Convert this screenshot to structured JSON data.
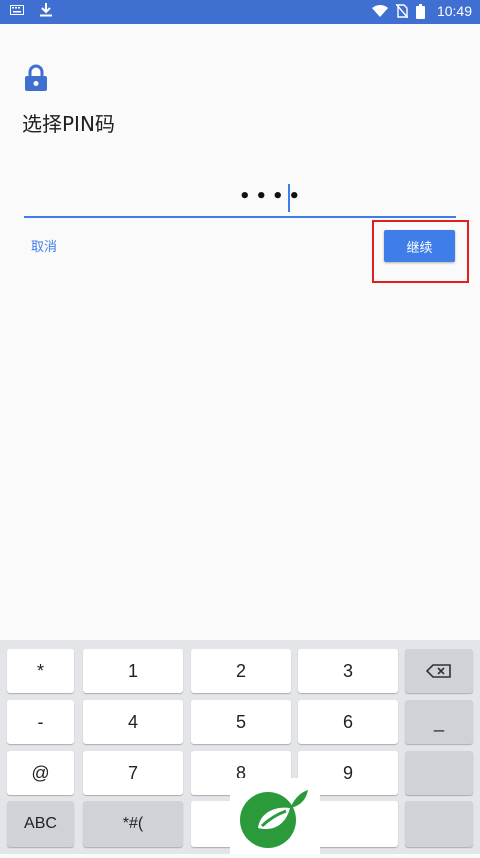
{
  "status_bar": {
    "time": "10:49",
    "left_icons": [
      "keyboard-icon",
      "download-icon"
    ],
    "right_icons": [
      "wifi-icon",
      "no-sim-icon",
      "battery-icon"
    ],
    "background": "#3f6fd1"
  },
  "screen": {
    "title": "选择PIN码",
    "pin_masked": "••••",
    "cancel_label": "取消",
    "continue_label": "继续",
    "accent": "#3f7ee8"
  },
  "keyboard": {
    "rows": [
      [
        "*",
        "1",
        "2",
        "3",
        "backspace"
      ],
      [
        "-",
        "4",
        "5",
        "6",
        "_"
      ],
      [
        "@",
        "7",
        "8",
        "9",
        ""
      ],
      [
        "ABC",
        "*#(",
        "",
        "",
        ""
      ]
    ]
  }
}
